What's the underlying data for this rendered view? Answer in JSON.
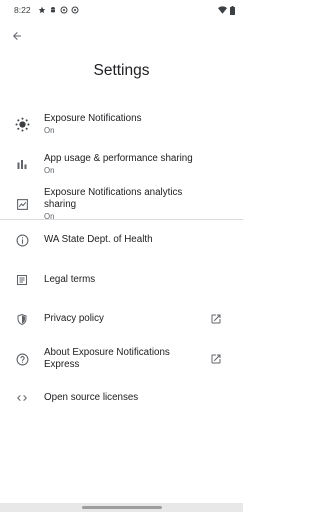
{
  "status_bar": {
    "time": "8:22",
    "left_icons": [
      "star-icon",
      "android-icon",
      "at-sign-icon",
      "at-sign-icon"
    ],
    "right_icons": [
      "wifi-icon",
      "battery-icon"
    ]
  },
  "header": {
    "back_icon": "arrow-back-icon",
    "title": "Settings"
  },
  "settings": {
    "items": [
      {
        "label": "Exposure Notifications",
        "sub": "On",
        "icon": "exposure-notifications-icon"
      },
      {
        "label": "App usage & performance sharing",
        "sub": "On",
        "icon": "bar-chart-icon"
      },
      {
        "label": "Exposure Notifications analytics sharing",
        "sub": "On",
        "icon": "analytics-chart-icon"
      }
    ],
    "links": [
      {
        "label": "WA State Dept. of Health",
        "icon": "info-icon"
      },
      {
        "label": "Legal terms",
        "icon": "document-icon"
      },
      {
        "label": "Privacy policy",
        "icon": "shield-icon",
        "external": true
      },
      {
        "label": "About Exposure Notifications Express",
        "icon": "help-icon",
        "external": true
      },
      {
        "label": "Open source licenses",
        "icon": "code-icon"
      }
    ]
  },
  "colors": {
    "text_primary": "#202124",
    "text_secondary": "#5f6368",
    "icon": "#5f6368",
    "divider": "#dadce0",
    "background": "#ffffff"
  }
}
